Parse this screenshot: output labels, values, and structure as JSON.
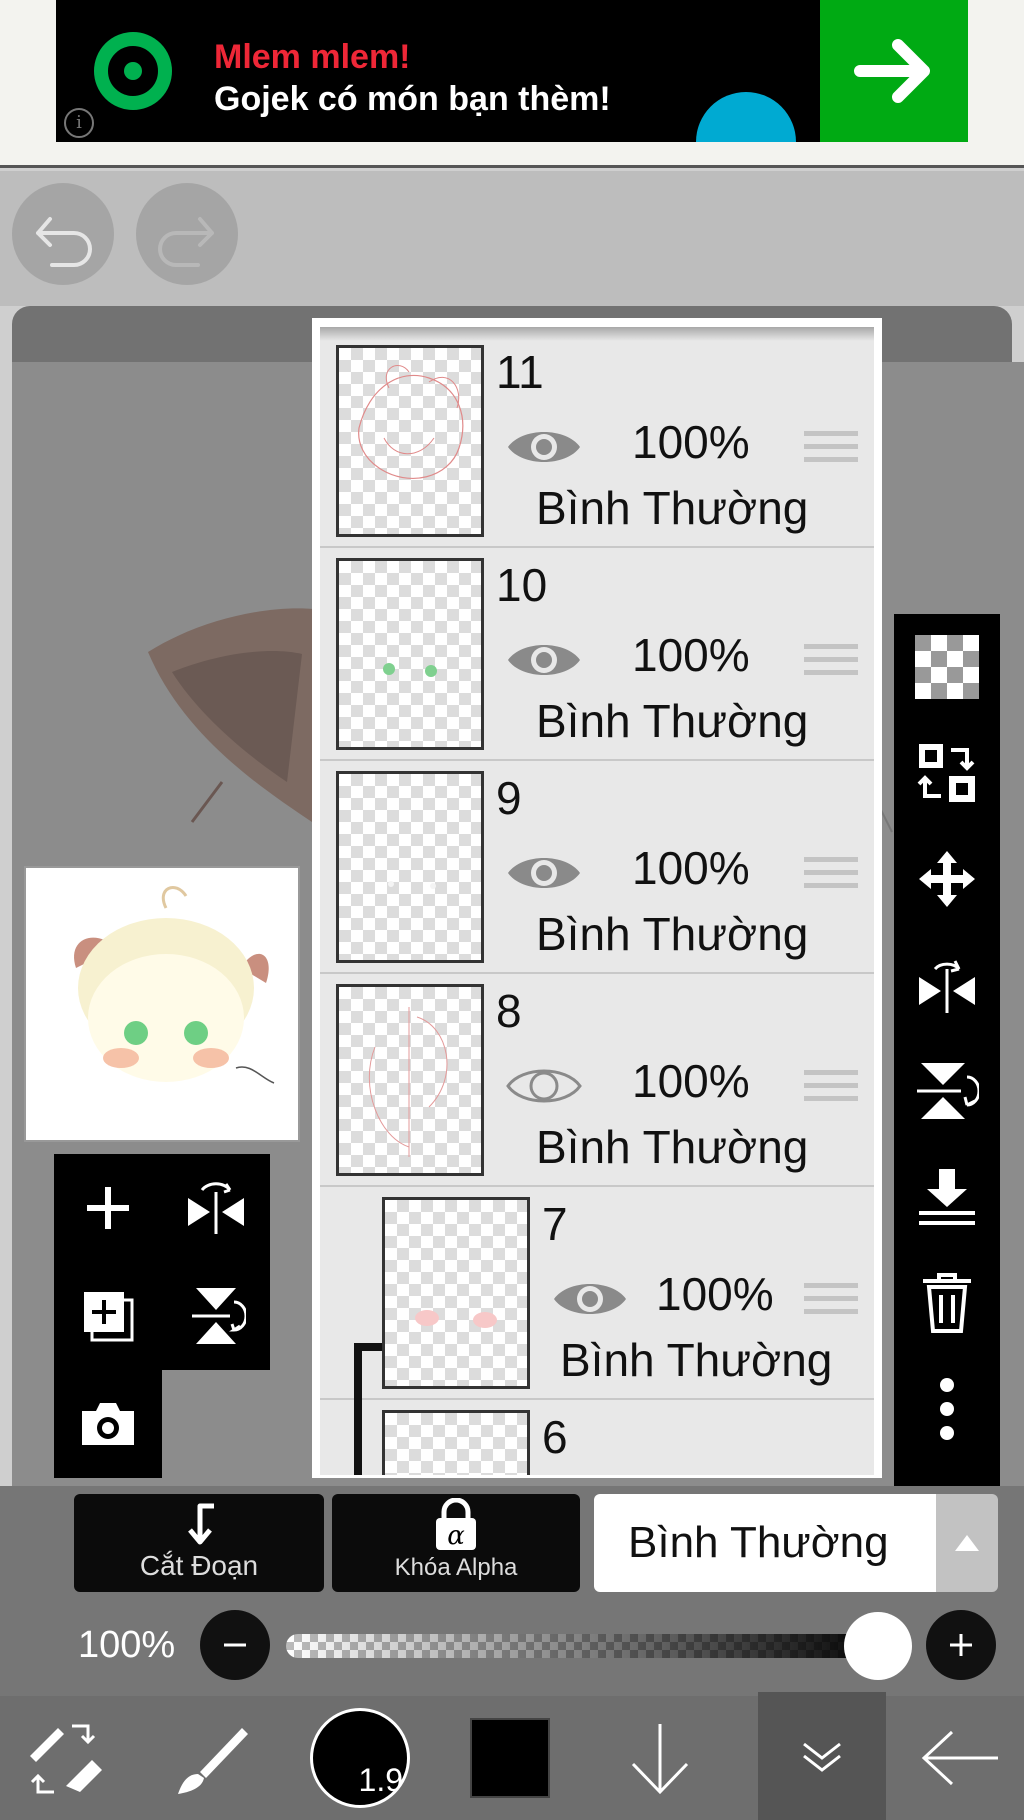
{
  "ad": {
    "headline": "Mlem mlem!",
    "subline": "Gojek có món bạn thèm!",
    "info": "i",
    "colors": {
      "brand_green": "#00aa13",
      "headline_red": "#ee2737"
    }
  },
  "history": {
    "undo_icon": "undo-icon",
    "redo_icon": "redo-icon"
  },
  "layers": [
    {
      "number": "11",
      "opacity": "100%",
      "blend": "Bình Thường",
      "visible": true,
      "clipped": false
    },
    {
      "number": "10",
      "opacity": "100%",
      "blend": "Bình Thường",
      "visible": true,
      "clipped": false
    },
    {
      "number": "9",
      "opacity": "100%",
      "blend": "Bình Thường",
      "visible": true,
      "clipped": false
    },
    {
      "number": "8",
      "opacity": "100%",
      "blend": "Bình Thường",
      "visible": false,
      "clipped": false
    },
    {
      "number": "7",
      "opacity": "100%",
      "blend": "Bình Thường",
      "visible": true,
      "clipped": true
    },
    {
      "number": "6",
      "opacity": "",
      "blend": "",
      "visible": true,
      "clipped": true
    }
  ],
  "controls": {
    "clipping_label": "Cắt Đoạn",
    "alpha_lock_label": "Khóa Alpha",
    "blend_mode": "Bình Thường",
    "opacity_label": "100%",
    "opacity_value": 100
  },
  "toolbar": {
    "brush_size": "1.9",
    "current_color": "#000000"
  }
}
